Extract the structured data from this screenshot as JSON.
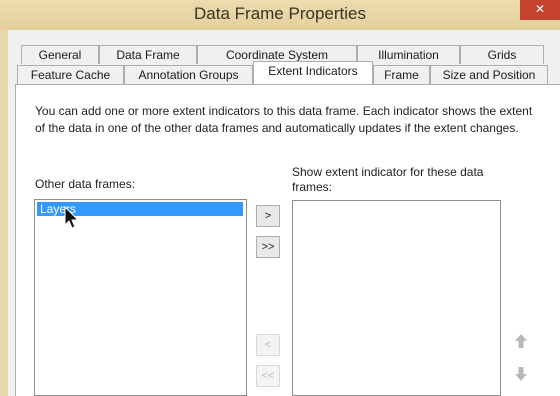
{
  "window": {
    "title": "Data Frame Properties",
    "close_label": "✕"
  },
  "tabs_row1": [
    {
      "label": "General"
    },
    {
      "label": "Data Frame"
    },
    {
      "label": "Coordinate System"
    },
    {
      "label": "Illumination"
    },
    {
      "label": "Grids"
    }
  ],
  "tabs_row2": [
    {
      "label": "Feature Cache"
    },
    {
      "label": "Annotation Groups"
    },
    {
      "label": "Extent Indicators",
      "active": true
    },
    {
      "label": "Frame"
    },
    {
      "label": "Size and Position"
    }
  ],
  "description": "You can add one or more extent indicators to this data frame.  Each indicator shows the extent of the data in one of the other data frames and automatically updates if the extent changes.",
  "other_frames": {
    "label": "Other data frames:",
    "items": [
      "Layers"
    ],
    "selected_index": 0
  },
  "show_frames": {
    "label": "Show extent indicator for these data frames:",
    "items": []
  },
  "buttons": {
    "add": ">",
    "add_all": ">>",
    "remove": "<",
    "remove_all": "<<",
    "move_up": "🡅",
    "move_down": "🡇"
  }
}
